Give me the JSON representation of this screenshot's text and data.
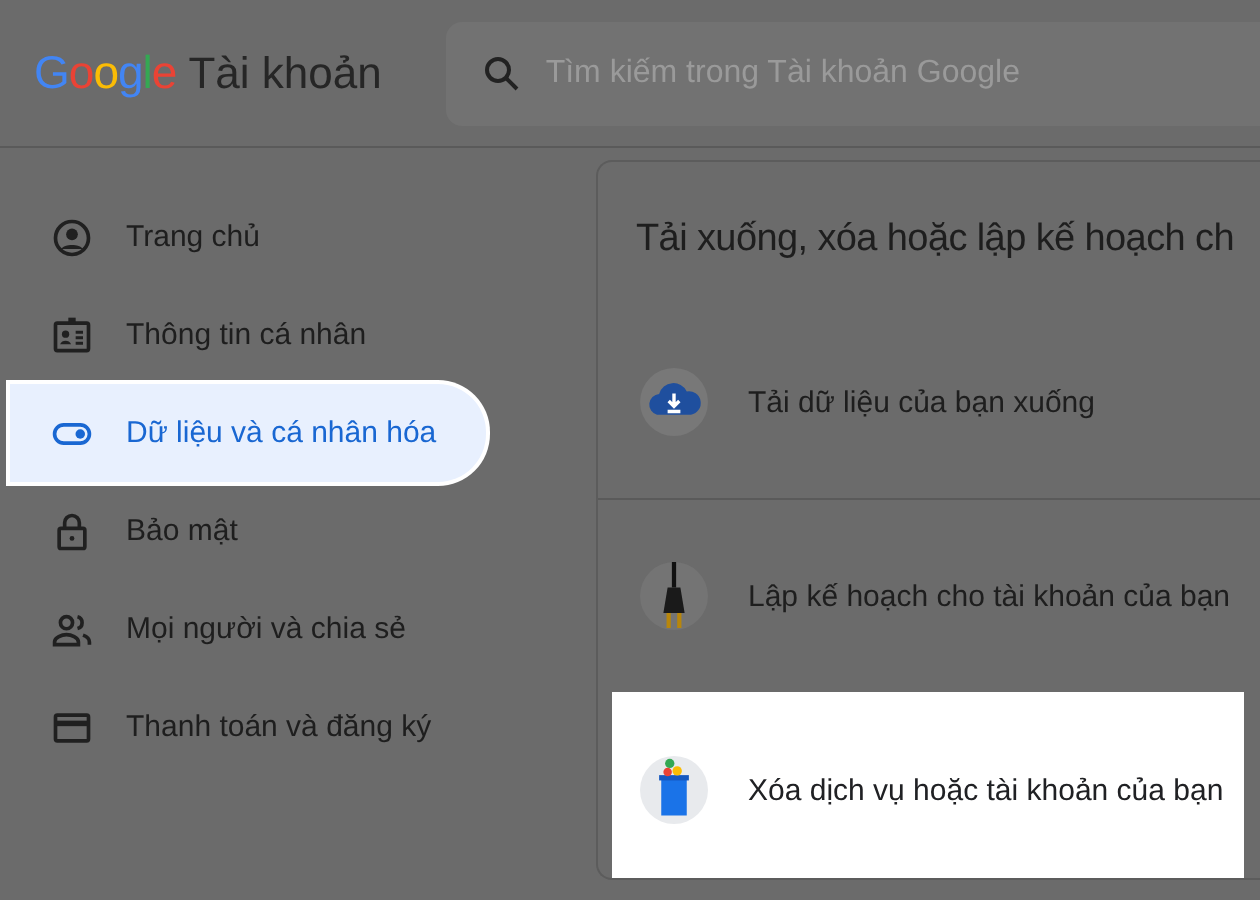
{
  "header": {
    "logo": "Google",
    "product": "Tài khoản",
    "search": {
      "placeholder": "Tìm kiếm trong Tài khoản Google"
    }
  },
  "sidebar": {
    "items": [
      {
        "label": "Trang chủ",
        "selected": false
      },
      {
        "label": "Thông tin cá nhân",
        "selected": false
      },
      {
        "label": "Dữ liệu và cá nhân hóa",
        "selected": true
      },
      {
        "label": "Bảo mật",
        "selected": false
      },
      {
        "label": "Mọi người và chia sẻ",
        "selected": false
      },
      {
        "label": "Thanh toán và đăng ký",
        "selected": false
      }
    ]
  },
  "main": {
    "title": "Tải xuống, xóa hoặc lập kế hoạch ch",
    "rows": [
      {
        "label": "Tải dữ liệu của bạn xuống",
        "highlighted": false
      },
      {
        "label": "Lập kế hoạch cho tài khoản của bạn",
        "highlighted": false
      },
      {
        "label": "Xóa dịch vụ hoặc tài khoản của bạn",
        "highlighted": true
      }
    ]
  }
}
